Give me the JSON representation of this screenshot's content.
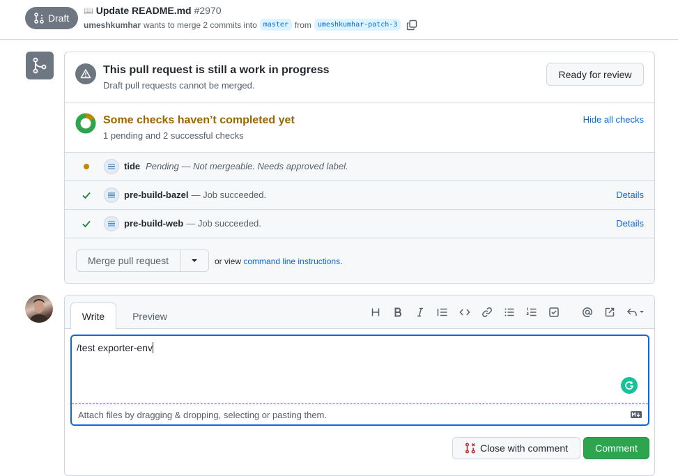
{
  "header": {
    "draft_label": "Draft",
    "title_emoji": "📖",
    "title": "Update README.md",
    "number": "#2970",
    "author": "umeshkumhar",
    "merge_text": "wants to merge 2 commits into",
    "base_branch": "master",
    "from_text": "from",
    "head_branch": "umeshkumhar-patch-3"
  },
  "merge_box": {
    "wip_title": "This pull request is still a work in progress",
    "wip_sub": "Draft pull requests cannot be merged.",
    "ready_button": "Ready for review",
    "checks_title": "Some checks haven’t completed yet",
    "checks_sub": "1 pending and 2 successful checks",
    "hide_checks": "Hide all checks",
    "checks": [
      {
        "name": "tide",
        "description": "Pending — Not mergeable. Needs approved label.",
        "status": "pending",
        "details": ""
      },
      {
        "name": "pre-build-bazel",
        "description": "— Job succeeded.",
        "status": "success",
        "details": "Details"
      },
      {
        "name": "pre-build-web",
        "description": "— Job succeeded.",
        "status": "success",
        "details": "Details"
      }
    ],
    "merge_button": "Merge pull request",
    "or_view": "or view",
    "cli_link": "command line instructions",
    "period": "."
  },
  "comment": {
    "tab_write": "Write",
    "tab_preview": "Preview",
    "text": "/test exporter-env",
    "attach_text": "Attach files by dragging & dropping, selecting or pasting them.",
    "close_button": "Close with comment",
    "comment_button": "Comment"
  },
  "colors": {
    "pending": "#bf8700",
    "success": "#1a7f37",
    "link": "#0969da",
    "primary_button": "#2da44e",
    "draft_badge": "#6e7781"
  }
}
